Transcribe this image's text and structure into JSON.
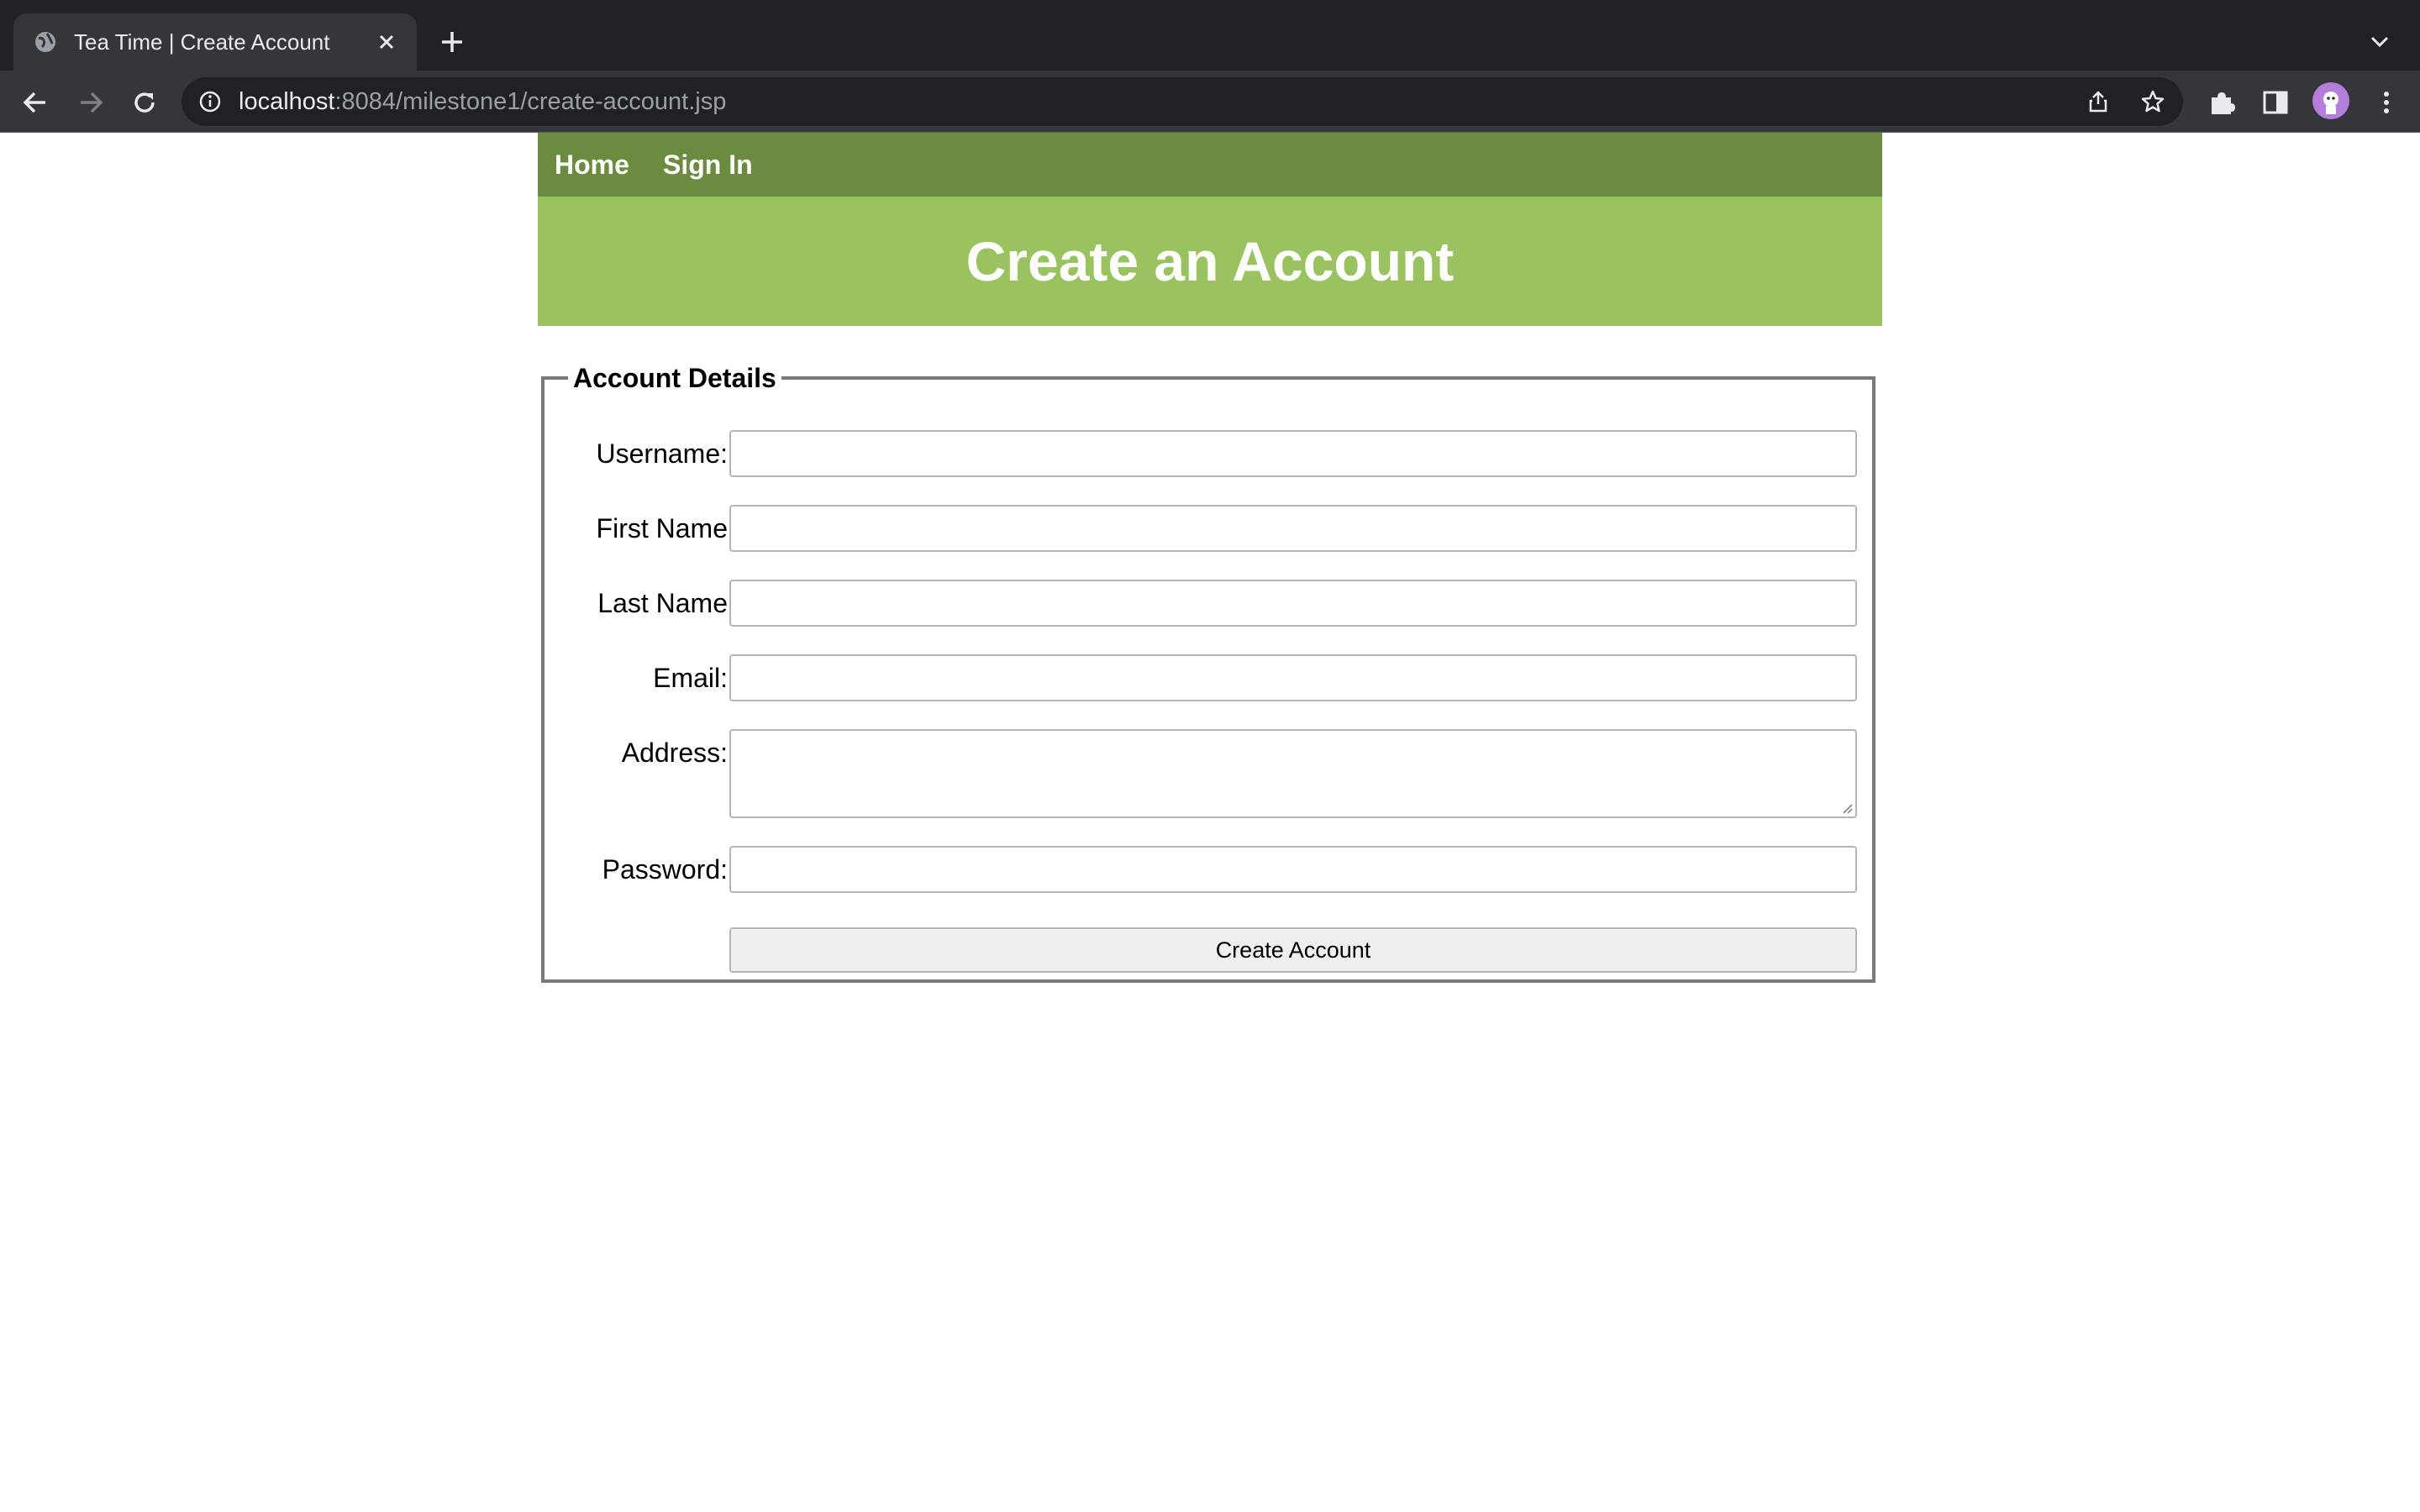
{
  "browser": {
    "tab_title": "Tea Time | Create Account",
    "url_host": "localhost",
    "url_rest": ":8084/milestone1/create-account.jsp"
  },
  "nav": {
    "links": [
      "Home",
      "Sign In"
    ]
  },
  "banner": {
    "title": "Create an Account"
  },
  "form": {
    "legend": "Account Details",
    "fields": [
      {
        "label": "Username:",
        "value": ""
      },
      {
        "label": "First Name",
        "value": ""
      },
      {
        "label": "Last Name",
        "value": ""
      },
      {
        "label": "Email:",
        "value": ""
      },
      {
        "label": "Address:",
        "value": ""
      },
      {
        "label": "Password:",
        "value": ""
      }
    ],
    "submit_label": "Create Account"
  },
  "colors": {
    "nav_bg": "#6b8b3f",
    "banner_bg": "#99c35e",
    "avatar": "#b57edc"
  }
}
